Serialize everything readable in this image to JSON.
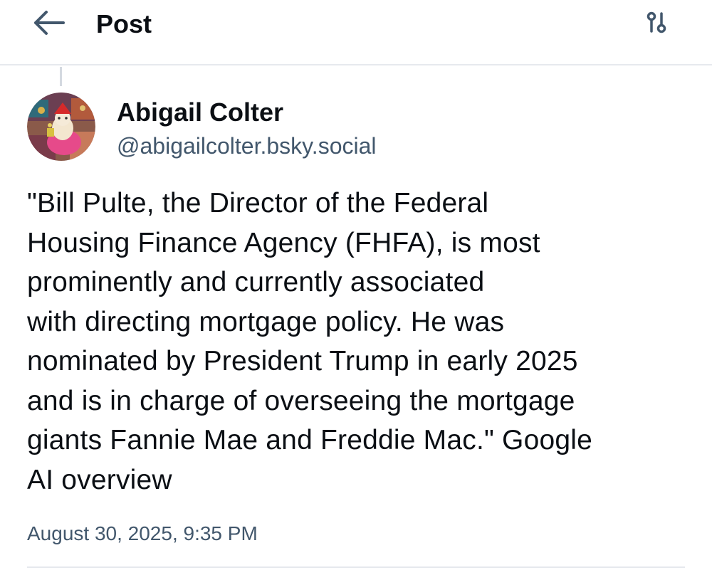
{
  "header": {
    "title": "Post",
    "back_icon": "arrow-left-icon",
    "filter_icon": "sliders-icon"
  },
  "post": {
    "author": {
      "display_name": "Abigail Colter",
      "handle": "@abigailcolter.bsky.social"
    },
    "text": "\"Bill Pulte, the Director of the Federal\nHousing Finance Agency (FHFA), is most\nprominently and currently associated\nwith directing mortgage policy. He was\nnominated by President Trump in early 2025\nand is in charge of overseeing the mortgage\ngiants Fannie Mae and Freddie Mac.\" Google\nAI overview",
    "timestamp": "August 30, 2025, 9:35 PM"
  },
  "colors": {
    "text_primary": "#0b0f14",
    "text_secondary": "#42576c",
    "icon": "#42576c",
    "border": "#e6e9ee"
  }
}
